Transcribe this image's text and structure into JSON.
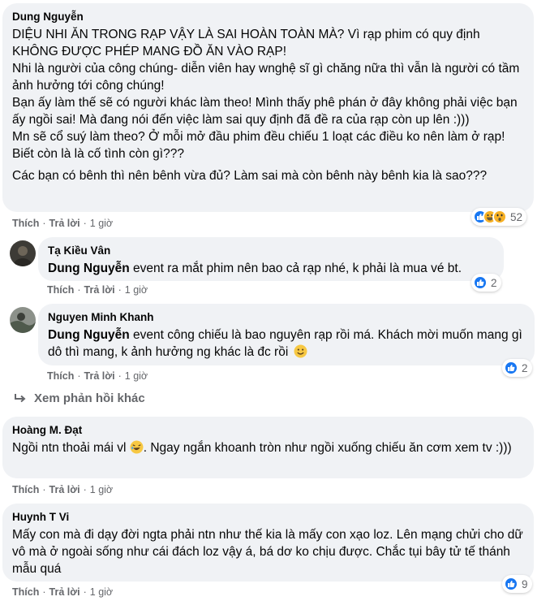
{
  "comments": [
    {
      "author": "Dung Nguyễn",
      "paragraphs": [
        "DIỆU NHI ĂN TRONG RẠP VẬY LÀ SAI HOÀN TOÀN MÀ? Vì rạp phim có quy định KHÔNG ĐƯỢC PHÉP MANG ĐỒ ĂN VÀO RẠP!",
        "Nhi là người của công chúng- diễn viên hay wnghệ sĩ gì chăng nữa thì vẫn là người có tầm ảnh hưởng tới công chúng!",
        "Bạn ấy làm thế sẽ có người khác làm theo! Mình thấy phê phán ở đây không phải việc bạn ấy ngồi sai! Mà đang nói đến việc làm sai quy định đã đề ra của rạp còn up lên :)))",
        "Mn sẽ cổ suý làm theo? Ở mỗi mở đầu phim đều chiếu 1 loạt các điều ko nên làm ở rạp! Biết còn là là cố tình còn gì???",
        "Các bạn có bênh thì nên bênh vừa đủ? Làm sai mà còn bênh này bênh kia là sao???"
      ],
      "like": "Thích",
      "reply": "Trả lời",
      "time": "1 giờ",
      "reaction_count": "52",
      "reaction_icons": [
        "like-icon",
        "haha-icon",
        "wow-icon"
      ]
    },
    {
      "author": "Tạ Kiều Vân",
      "mention": "Dung Nguyễn",
      "text": " event ra mắt phim nên bao cả rạp nhé, k phải là mua vé bt.",
      "like": "Thích",
      "reply": "Trả lời",
      "time": "1 giờ",
      "reaction_count": "2"
    },
    {
      "author": "Nguyen Minh Khanh",
      "mention": "Dung Nguyễn",
      "text": " event công chiếu là bao nguyên rạp rồi má. Khách mời muốn mang gì dô thì mang, k ảnh hưởng ng khác là đc rồi",
      "like": "Thích",
      "reply": "Trả lời",
      "time": "1 giờ",
      "reaction_count": "2"
    },
    {
      "author": "Hoàng M. Đạt",
      "text_before": "Ngồi ntn thoải mái vl",
      "text_after": ". Ngay ngắn khoanh tròn như ngồi xuống chiếu ăn cơm xem tv :)))",
      "like": "Thích",
      "reply": "Trả lời",
      "time": "1 giờ"
    },
    {
      "author": "Huynh T Vi",
      "text": "Mấy con mà đi dạy đời ngta phải ntn như thế kia là mấy con xạo loz. Lên mạng chửi cho dữ vô mà ở ngoài sống như cái đách loz vậy á, bá dơ ko chịu được. Chắc tụi bây tử tế thánh mẫu quá",
      "like": "Thích",
      "reply": "Trả lời",
      "time": "1 giờ",
      "reaction_count": "9"
    }
  ],
  "more_replies": "Xem phản hồi khác",
  "colors": {
    "bubble": "#f0f2f5",
    "secondary_text": "#65676b",
    "like_blue": "#1877f2",
    "emoji_yellow": "#f7b125"
  }
}
